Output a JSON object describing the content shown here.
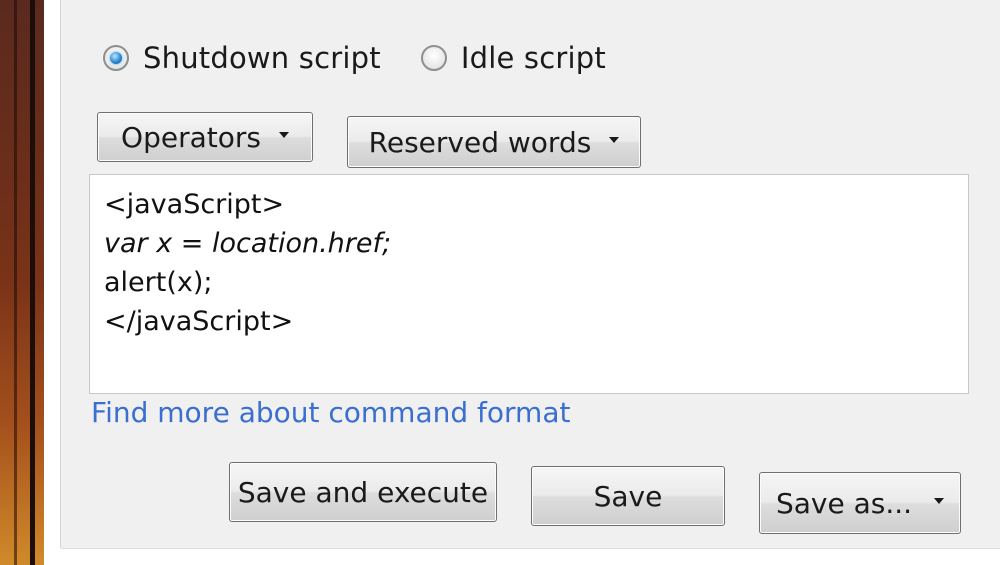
{
  "script_type": {
    "options": [
      {
        "label": "Shutdown script",
        "checked": true
      },
      {
        "label": "Idle script",
        "checked": false
      }
    ]
  },
  "toolbar": {
    "operators_label": "Operators",
    "reserved_words_label": "Reserved words"
  },
  "editor": {
    "lines": [
      "<javaScript>",
      "var x = location.href;",
      "alert(x);",
      "</javaScript>"
    ]
  },
  "help_link": "Find more about command format",
  "actions": {
    "save_and_execute": "Save and execute",
    "save": "Save",
    "save_as": "Save as..."
  },
  "colors": {
    "link": "#3a6fd1",
    "radio_selected": "#2a8ad6",
    "dialog_bg": "#f0f0f0"
  }
}
